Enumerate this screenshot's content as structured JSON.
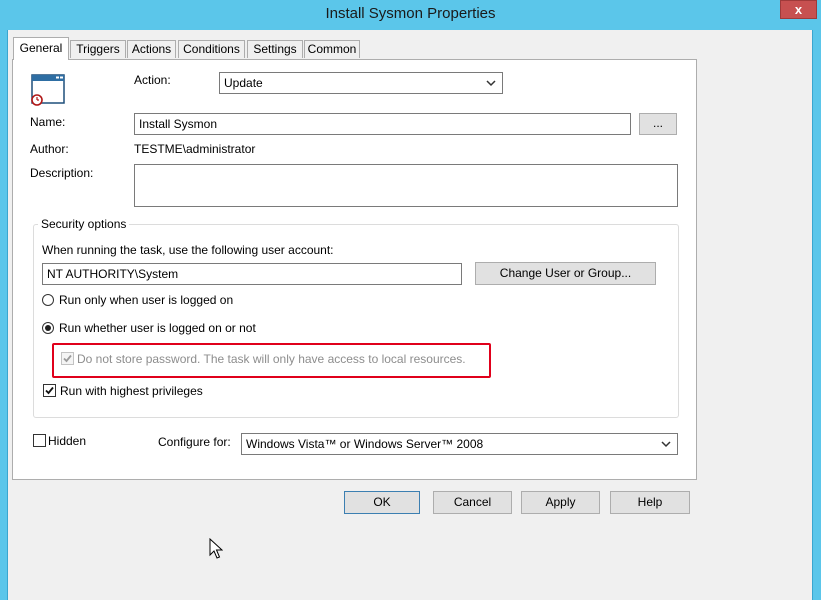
{
  "window": {
    "title": "Install Sysmon Properties",
    "close_label": "x"
  },
  "tabs": [
    {
      "label": "General",
      "active": true
    },
    {
      "label": "Triggers"
    },
    {
      "label": "Actions"
    },
    {
      "label": "Conditions"
    },
    {
      "label": "Settings"
    },
    {
      "label": "Common"
    }
  ],
  "general": {
    "action_label": "Action:",
    "action_value": "Update",
    "name_label": "Name:",
    "name_value": "Install Sysmon",
    "browse_label": "...",
    "author_label": "Author:",
    "author_value": "TESTME\\administrator",
    "description_label": "Description:",
    "description_value": ""
  },
  "security": {
    "legend": "Security options",
    "account_prompt": "When running the task, use the following user account:",
    "account_value": "NT AUTHORITY\\System",
    "change_user_label": "Change User or Group...",
    "radio_logged_on": "Run only when user is logged on",
    "radio_whether": "Run whether user is logged on or not",
    "no_store_password": "Do not store password. The task will only have access to local resources.",
    "highest_privileges": "Run with highest privileges"
  },
  "bottom": {
    "hidden_label": "Hidden",
    "configure_label": "Configure for:",
    "configure_value": "Windows Vista™ or Windows Server™ 2008"
  },
  "buttons": {
    "ok": "OK",
    "cancel": "Cancel",
    "apply": "Apply",
    "help": "Help"
  },
  "colors": {
    "title_bar": "#5bc6ea",
    "close_button": "#c75050",
    "highlight": "#e0001b"
  }
}
